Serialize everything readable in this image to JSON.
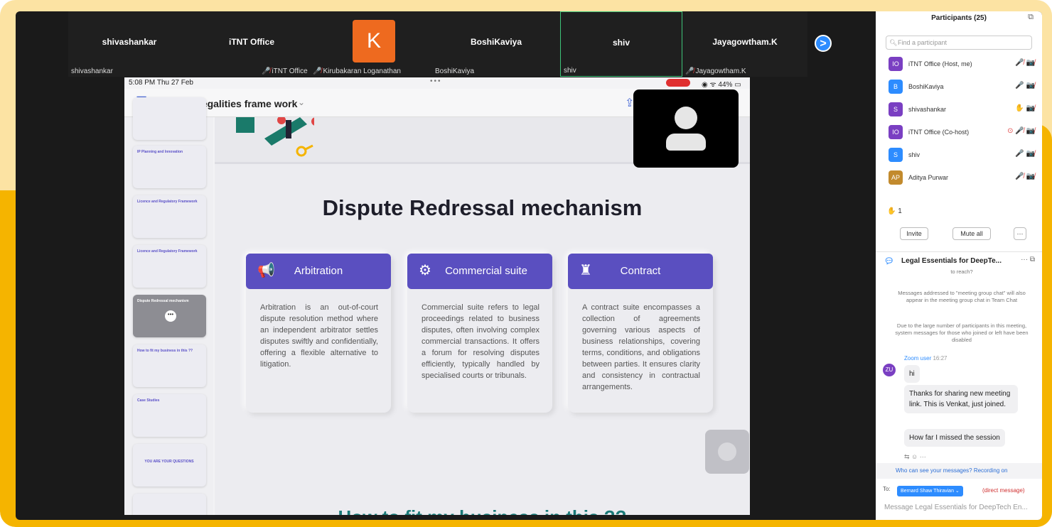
{
  "gallery": {
    "tiles": [
      {
        "name": "shivashankar",
        "label": "shivashankar",
        "muted": false
      },
      {
        "name": "iTNT Office",
        "label": "iTNT Office",
        "muted": true
      },
      {
        "name": "",
        "label": "Kirubakaran Loganathan",
        "muted": true,
        "avatar_letter": "K"
      },
      {
        "name": "BoshiKaviya",
        "label": "BoshiKaviya",
        "muted": false
      },
      {
        "name": "shiv",
        "label": "shiv",
        "muted": false
      },
      {
        "name": "Jayagowtham.K",
        "label": "Jayagowtham.K",
        "muted": true
      }
    ],
    "next_arrow": ">"
  },
  "ipad": {
    "time": "5:08 PM  Thu 27 Feb",
    "battery": "44%",
    "doc_title": "Startup legalities frame work"
  },
  "thumbs": [
    {
      "text": ""
    },
    {
      "text": "IP Planning and Innovation"
    },
    {
      "text": "Licence and Regulatory Framework"
    },
    {
      "text": "Licence and Regulatory Framework"
    },
    {
      "text": "Dispute Redressal mechanism",
      "selected": true
    },
    {
      "text": "How to fit my business in this ??"
    },
    {
      "text": "Case Studies"
    },
    {
      "text": "YOU ARE YOUR QUESTIONS"
    }
  ],
  "slide": {
    "title": "Dispute Redressal mechanism",
    "cards": [
      {
        "title": "Arbitration",
        "icon": "megaphone-icon",
        "glyph": "📢",
        "body": "Arbitration is an out-of-court dispute resolution method where an independent arbitrator settles disputes swiftly and confidentially, offering a flexible alternative to litigation."
      },
      {
        "title": "Commercial suite",
        "icon": "gear-bulb-icon",
        "glyph": "⚙",
        "body": "Commercial suite refers to legal proceedings related to business disputes, often involving complex commercial transactions. It offers a forum for resolving disputes efficiently, typically handled by specialised courts or tribunals."
      },
      {
        "title": "Contract",
        "icon": "rook-icon",
        "glyph": "♜",
        "body": "A contract suite encompasses a collection of agreements governing various aspects of business relationships, covering terms, conditions, and obligations between parties. It ensures clarity and consistency in contractual arrangements."
      }
    ],
    "next_heading": "How to fit my business in this ??"
  },
  "panel": {
    "title": "Participants (25)",
    "search_placeholder": "Find a participant",
    "participants": [
      {
        "initials": "IO",
        "name": "iTNT Office (Host, me)",
        "color": "#7a3fc2",
        "icons": "🎤̸ 📷̸"
      },
      {
        "initials": "B",
        "name": "BoshiKaviya",
        "color": "#2d8cff",
        "icons": "🎤 📷̸"
      },
      {
        "initials": "S",
        "name": "shivashankar",
        "color": "#7a3fc2",
        "icons": "✋ 📷̸"
      },
      {
        "initials": "IO",
        "name": "iTNT Office (Co-host)",
        "color": "#7a3fc2",
        "icons": "⊙ 🎤̸ 📷̸"
      },
      {
        "initials": "S",
        "name": "shiv",
        "color": "#2d8cff",
        "icons": "🎤 📷̸"
      },
      {
        "initials": "AP",
        "name": "Aditya Purwar",
        "color": "#c28a2d",
        "icons": "🎤̸ 📷̸"
      }
    ],
    "hand_count": "1",
    "invite_label": "Invite",
    "mute_all_label": "Mute all",
    "more_label": "···"
  },
  "chat": {
    "title": "Legal Essentials for DeepTe...",
    "cut_message": "to reach?",
    "system_1": "Messages addressed to \"meeting group chat\" will also appear in the meeting group chat in Team Chat",
    "system_2": "Due to the large number of participants in this meeting, system messages for those who joined or left have been disabled",
    "sender": "Zoom user",
    "sender_time": "16:27",
    "sender_initials": "ZU",
    "messages": [
      "hi",
      "Thanks for sharing new meeting link. This is Venkat, just joined.",
      "How far I missed the session"
    ],
    "who_can_see": "Who can see your messages? Recording on",
    "to_label": "To:",
    "to_recipient": "Bernard Shaw Thiravian ⌄",
    "direct_label": "(direct message)",
    "input_placeholder": "Message Legal Essentials for DeepTech En..."
  }
}
